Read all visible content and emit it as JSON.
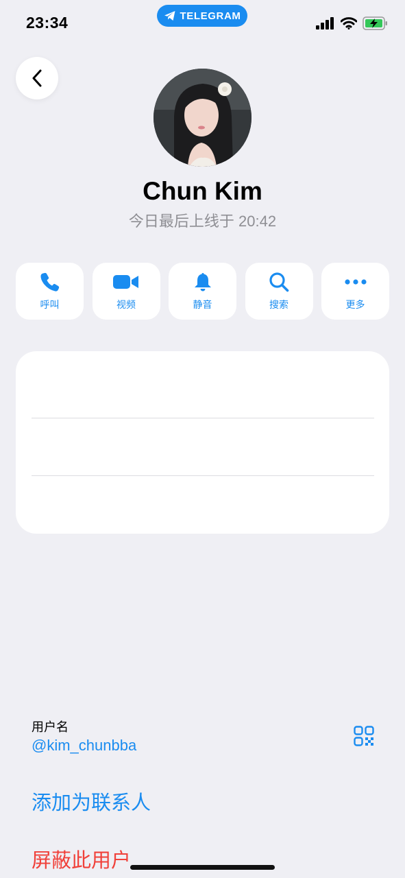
{
  "status_bar": {
    "time": "23:34",
    "app_pill_label": "TELEGRAM",
    "battery_color": "#34c759"
  },
  "profile": {
    "name": "Chun Kim",
    "last_seen": "今日最后上线于 20:42"
  },
  "actions": [
    {
      "label": "呼叫",
      "icon": "phone-icon"
    },
    {
      "label": "视频",
      "icon": "video-camera-icon"
    },
    {
      "label": "静音",
      "icon": "bell-icon"
    },
    {
      "label": "搜索",
      "icon": "search-icon"
    },
    {
      "label": "更多",
      "icon": "more-dots-icon"
    }
  ],
  "info": {
    "username_caption": "用户名",
    "username": "@kim_chunbba",
    "add_contact_label": "添加为联系人",
    "block_label": "屏蔽此用户"
  },
  "colors": {
    "accent": "#1a8cf0",
    "destructive": "#f0413a",
    "background": "#efeff4",
    "secondary_text": "#8e8e93"
  }
}
